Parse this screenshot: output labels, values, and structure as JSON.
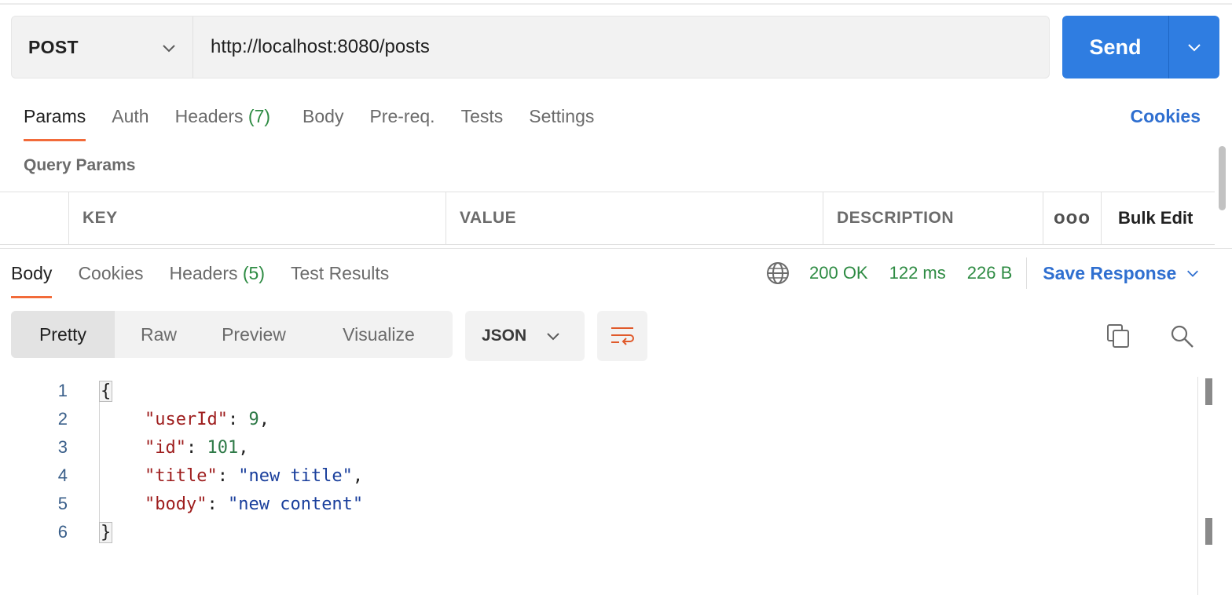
{
  "request": {
    "method": "POST",
    "url": "http://localhost:8080/posts",
    "send_label": "Send"
  },
  "request_tabs": {
    "params": "Params",
    "auth": "Auth",
    "headers": "Headers",
    "headers_count": "(7)",
    "body": "Body",
    "prereq": "Pre-req.",
    "tests": "Tests",
    "settings": "Settings",
    "cookies": "Cookies"
  },
  "query_params": {
    "title": "Query Params",
    "columns": [
      "KEY",
      "VALUE",
      "DESCRIPTION"
    ],
    "more": "ooo",
    "bulk_edit": "Bulk Edit"
  },
  "response_tabs": {
    "body": "Body",
    "cookies": "Cookies",
    "headers": "Headers",
    "headers_count": "(5)",
    "test_results": "Test Results"
  },
  "response_status": {
    "status": "200 OK",
    "time": "122 ms",
    "size": "226 B",
    "save_response": "Save Response"
  },
  "view_modes": {
    "pretty": "Pretty",
    "raw": "Raw",
    "preview": "Preview",
    "visualize": "Visualize",
    "format": "JSON"
  },
  "code": {
    "line_numbers": [
      "1",
      "2",
      "3",
      "4",
      "5",
      "6"
    ],
    "open_brace": "{",
    "close_brace": "}",
    "lines": [
      {
        "key": "\"userId\"",
        "sep": ": ",
        "value": "9",
        "end": ","
      },
      {
        "key": "\"id\"",
        "sep": ": ",
        "value": "101",
        "end": ","
      },
      {
        "key": "\"title\"",
        "sep": ": ",
        "value": "\"new title\"",
        "end": ","
      },
      {
        "key": "\"body\"",
        "sep": ": ",
        "value": "\"new content\"",
        "end": ""
      }
    ]
  },
  "colors": {
    "accent_blue": "#2f7de1",
    "active_tab_underline": "#f26b3a",
    "status_green": "#2e8b43"
  }
}
